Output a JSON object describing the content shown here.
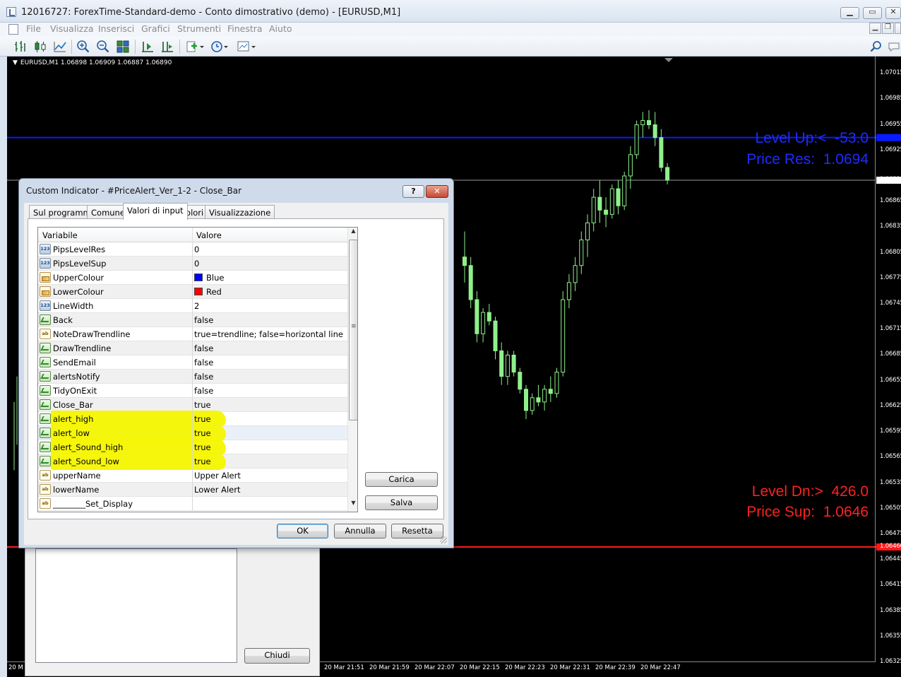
{
  "window": {
    "title": "12016727: ForexTime-Standard-demo - Conto dimostrativo (demo) - [EURUSD,M1]",
    "minimize": "▁",
    "maximize": "▭",
    "close": "✕"
  },
  "menu": [
    "File",
    "Visualizza",
    "Inserisci",
    "Grafici",
    "Strumenti",
    "Finestra",
    "Aiuto"
  ],
  "toolbar_icons": [
    "bar-chart-icon",
    "candlestick-icon",
    "line-chart-icon",
    "zoom-in-icon",
    "zoom-out-icon",
    "tile-windows-icon",
    "autoscroll-icon",
    "chart-shift-icon",
    "add-indicator-icon",
    "periods-icon",
    "templates-icon",
    "search-icon",
    "chat-icon"
  ],
  "chart": {
    "header": "EURUSD,M1  1.06898 1.06909 1.06887 1.06890",
    "colors": {
      "bull": "#8ff08a",
      "line_up": "#0a1bff",
      "line_dn": "#ff1a1a",
      "grid_current": "#9a9a9a"
    },
    "price_labels": [
      "1.07015",
      "1.06985",
      "1.06955",
      "1.06925",
      "1.06890",
      "1.06865",
      "1.06835",
      "1.06805",
      "1.06775",
      "1.06745",
      "1.06715",
      "1.06685",
      "1.06655",
      "1.06625",
      "1.06595",
      "1.06565",
      "1.06535",
      "1.06505",
      "1.06475",
      "1.06460",
      "1.06445",
      "1.06415",
      "1.06385",
      "1.06355",
      "1.06325"
    ],
    "time_labels": [
      "20 M",
      "20 Mar 21:51",
      "20 Mar 21:59",
      "20 Mar 22:07",
      "20 Mar 22:15",
      "20 Mar 22:23",
      "20 Mar 22:31",
      "20 Mar 22:39",
      "20 Mar 22:47"
    ],
    "level_up_text": "Level Up:<  -53.0",
    "price_res_text": "Price Res:  1.0694",
    "level_dn_text": "Level Dn:>  426.0",
    "price_sup_text": "Price Sup:  1.0646",
    "resistance_price": 1.0694,
    "support_price": 1.0646,
    "current_price": 1.0689,
    "y_range": [
      1.06325,
      1.07035
    ]
  },
  "chart_data": {
    "type": "candlestick",
    "symbol": "EURUSD,M1",
    "ohlc_header": [
      1.06898,
      1.06909,
      1.06887,
      1.0689
    ],
    "candles": [
      [
        1.068,
        1.0683,
        1.0677,
        1.0679
      ],
      [
        1.0679,
        1.068,
        1.0674,
        1.0675
      ],
      [
        1.0675,
        1.0676,
        1.067,
        1.0671
      ],
      [
        1.0671,
        1.0674,
        1.067,
        1.06735
      ],
      [
        1.06735,
        1.06745,
        1.0672,
        1.06725
      ],
      [
        1.06725,
        1.0673,
        1.0668,
        1.0669
      ],
      [
        1.0669,
        1.067,
        1.0665,
        1.0666
      ],
      [
        1.0666,
        1.0669,
        1.0665,
        1.06685
      ],
      [
        1.06685,
        1.0669,
        1.0666,
        1.06665
      ],
      [
        1.06665,
        1.0667,
        1.0664,
        1.06645
      ],
      [
        1.06645,
        1.0665,
        1.0661,
        1.0662
      ],
      [
        1.0662,
        1.0664,
        1.06615,
        1.06635
      ],
      [
        1.06635,
        1.0665,
        1.06625,
        1.0663
      ],
      [
        1.0663,
        1.0665,
        1.0662,
        1.06645
      ],
      [
        1.06645,
        1.0666,
        1.0663,
        1.0664
      ],
      [
        1.0664,
        1.0667,
        1.06635,
        1.06665
      ],
      [
        1.06665,
        1.0676,
        1.0666,
        1.0675
      ],
      [
        1.0675,
        1.0678,
        1.0674,
        1.0677
      ],
      [
        1.0677,
        1.068,
        1.0676,
        1.0679
      ],
      [
        1.0679,
        1.0683,
        1.0678,
        1.0682
      ],
      [
        1.0682,
        1.0685,
        1.068,
        1.0684
      ],
      [
        1.0684,
        1.0688,
        1.0683,
        1.0687
      ],
      [
        1.0687,
        1.0689,
        1.0684,
        1.06855
      ],
      [
        1.06855,
        1.0687,
        1.06835,
        1.0685
      ],
      [
        1.0685,
        1.06885,
        1.06845,
        1.0688
      ],
      [
        1.0688,
        1.0689,
        1.0685,
        1.0686
      ],
      [
        1.0686,
        1.069,
        1.06855,
        1.06895
      ],
      [
        1.06895,
        1.0693,
        1.0688,
        1.0692
      ],
      [
        1.0692,
        1.0696,
        1.06915,
        1.06955
      ],
      [
        1.06955,
        1.0697,
        1.0694,
        1.0696
      ],
      [
        1.0696,
        1.06972,
        1.0695,
        1.06955
      ],
      [
        1.06955,
        1.0697,
        1.0693,
        1.0694
      ],
      [
        1.0694,
        1.0695,
        1.069,
        1.06905
      ],
      [
        1.06905,
        1.0691,
        1.06885,
        1.0689
      ]
    ]
  },
  "dialog": {
    "title": "Custom Indicator - #PriceAlert_Ver_1-2 - Close_Bar",
    "help": "?",
    "close": "✕",
    "tabs": [
      "Sul programma",
      "Comune",
      "Valori di input",
      "Colori",
      "Visualizzazione"
    ],
    "active_tab": 2,
    "columns": [
      "Variabile",
      "Valore"
    ],
    "rows": [
      {
        "icon": "num",
        "name": "PipsLevelRes",
        "value": "0"
      },
      {
        "icon": "num",
        "name": "PipsLevelSup",
        "value": "0"
      },
      {
        "icon": "col",
        "name": "UpperColour",
        "value": "Blue",
        "swatch": "#0000ff"
      },
      {
        "icon": "col",
        "name": "LowerColour",
        "value": "Red",
        "swatch": "#ff0000"
      },
      {
        "icon": "num",
        "name": "LineWidth",
        "value": "2"
      },
      {
        "icon": "bool",
        "name": "Back",
        "value": "false"
      },
      {
        "icon": "str",
        "name": "NoteDrawTrendline",
        "value": "true=trendline; false=horizontal line"
      },
      {
        "icon": "bool",
        "name": "DrawTrendline",
        "value": "false"
      },
      {
        "icon": "bool",
        "name": "SendEmail",
        "value": "false"
      },
      {
        "icon": "bool",
        "name": "alertsNotify",
        "value": "false"
      },
      {
        "icon": "bool",
        "name": "TidyOnExit",
        "value": "false"
      },
      {
        "icon": "bool",
        "name": "Close_Bar",
        "value": "true"
      },
      {
        "icon": "bool",
        "name": "alert_high",
        "value": "true",
        "highlight": true
      },
      {
        "icon": "bool",
        "name": "alert_low",
        "value": "true",
        "highlight": true
      },
      {
        "icon": "bool",
        "name": "alert_Sound_high",
        "value": "true",
        "highlight": true
      },
      {
        "icon": "bool",
        "name": "alert_Sound_low",
        "value": "true",
        "highlight": true
      },
      {
        "icon": "str",
        "name": "upperName",
        "value": "Upper Alert"
      },
      {
        "icon": "str",
        "name": "lowerName",
        "value": "Lower Alert"
      },
      {
        "icon": "str",
        "name": "________Set_Display",
        "value": ""
      }
    ],
    "icon_text": {
      "num": "123",
      "str": "ab"
    },
    "highlight_color": "#f5f500",
    "side_buttons": {
      "load": "Carica",
      "save": "Salva"
    },
    "buttons": {
      "ok": "OK",
      "cancel": "Annulla",
      "reset": "Resetta"
    }
  },
  "back_dialog": {
    "close_button": "Chiudi"
  }
}
